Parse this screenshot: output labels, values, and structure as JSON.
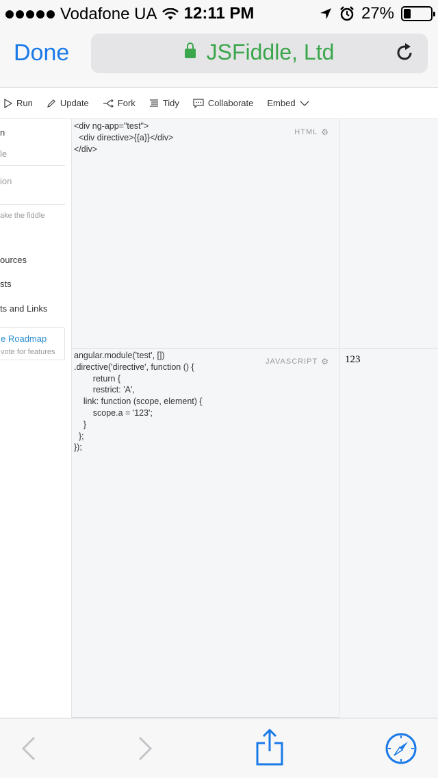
{
  "status": {
    "carrier": "Vodafone UA",
    "time": "12:11 PM",
    "battery": "27%",
    "battery_level": 0.27
  },
  "nav": {
    "done_label": "Done",
    "site": "JSFiddle, Ltd"
  },
  "toolbar": {
    "run": "Run",
    "update": "Update",
    "fork": "Fork",
    "tidy": "Tidy",
    "collaborate": "Collaborate",
    "embed": "Embed"
  },
  "sidebar": {
    "item1": "n",
    "item2": "le",
    "item3": "ion",
    "item4": "ake the fiddle",
    "item5": "ources",
    "item6": "sts",
    "item7": "ts and Links",
    "roadmap_title": "e Roadmap",
    "roadmap_sub": "vote for features"
  },
  "html_panel": {
    "label": "HTML",
    "code": "<div ng-app=\"test\">\n  <div directive>{{a}}</div>\n</div>"
  },
  "js_panel": {
    "label": "JAVASCRIPT",
    "code": "angular.module('test', [])\n.directive('directive', function () {\n        return {\n        restrict: 'A',\n    link: function (scope, element) {\n        scope.a = '123';\n    }\n  };\n});"
  },
  "result": {
    "text": "123"
  }
}
